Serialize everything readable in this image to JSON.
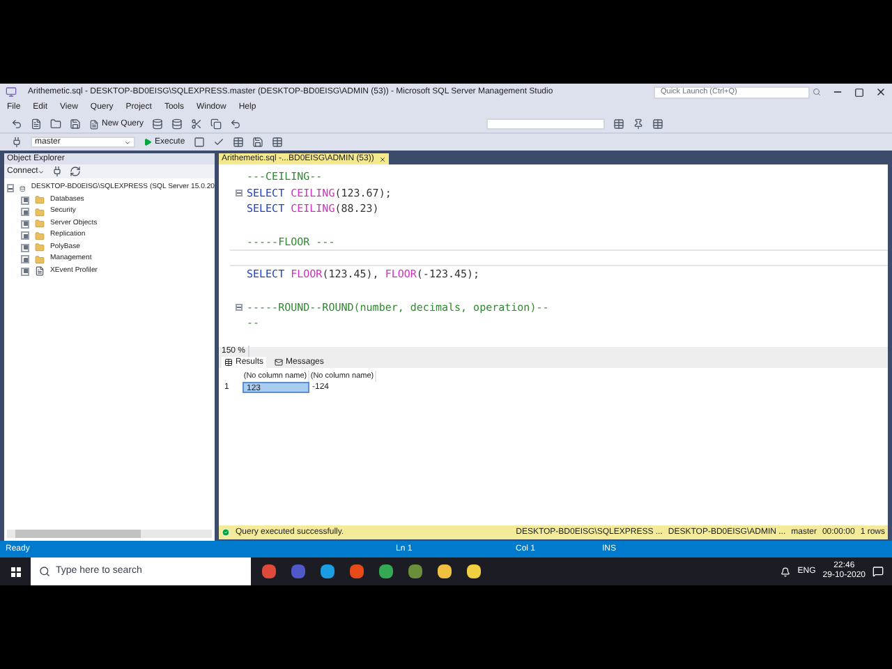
{
  "window": {
    "title": "Arithemetic.sql - DESKTOP-BD0EISG\\SQLEXPRESS.master (DESKTOP-BD0EISG\\ADMIN (53)) - Microsoft SQL Server Management Studio",
    "quick_launch": {
      "placeholder": "Quick Launch (Ctrl+Q)"
    }
  },
  "menu": [
    "File",
    "Edit",
    "View",
    "Query",
    "Project",
    "Tools",
    "Window",
    "Help"
  ],
  "toolbar": {
    "new_query": "New Query",
    "database": "master",
    "execute": "Execute"
  },
  "object_explorer": {
    "title": "Object Explorer",
    "connect": "Connect",
    "tree": [
      {
        "label": "DESKTOP-BD0EISG\\SQLEXPRESS (SQL Server 15.0.20",
        "kind": "server",
        "expanded": true,
        "children": [
          {
            "label": "Databases",
            "kind": "folder",
            "expanded": false
          },
          {
            "label": "Security",
            "kind": "folder",
            "expanded": false
          },
          {
            "label": "Server Objects",
            "kind": "folder",
            "expanded": false
          },
          {
            "label": "Replication",
            "kind": "folder",
            "expanded": false
          },
          {
            "label": "PolyBase",
            "kind": "folder",
            "expanded": false
          },
          {
            "label": "Management",
            "kind": "folder",
            "expanded": false
          },
          {
            "label": "XEvent Profiler",
            "kind": "profiler",
            "expanded": false
          }
        ]
      }
    ]
  },
  "editor": {
    "tab": {
      "label": "Arithemetic.sql -...BD0EISG\\ADMIN (53))",
      "selected": true
    },
    "zoom": "150 %",
    "lines": [
      {
        "fold": false,
        "current": false,
        "tokens": [
          {
            "kind": "comment",
            "text": "---CEILING--"
          }
        ]
      },
      {
        "fold": true,
        "current": false,
        "tokens": [
          {
            "kind": "keyword",
            "text": "SELECT "
          },
          {
            "kind": "function",
            "text": "CEILING"
          },
          {
            "kind": "plain",
            "text": "(123.67);"
          }
        ]
      },
      {
        "fold": false,
        "current": false,
        "tokens": [
          {
            "kind": "keyword",
            "text": "SELECT "
          },
          {
            "kind": "function",
            "text": "CEILING"
          },
          {
            "kind": "plain",
            "text": "(88.23)"
          }
        ]
      },
      {
        "fold": false,
        "current": false,
        "tokens": [
          {
            "kind": "blank"
          }
        ]
      },
      {
        "fold": false,
        "current": false,
        "tokens": [
          {
            "kind": "comment",
            "text": "-----FLOOR ---"
          }
        ]
      },
      {
        "fold": false,
        "current": true,
        "tokens": [
          {
            "kind": "blank"
          }
        ]
      },
      {
        "fold": false,
        "current": false,
        "tokens": [
          {
            "kind": "keyword",
            "text": "SELECT "
          },
          {
            "kind": "function",
            "text": "FLOOR"
          },
          {
            "kind": "plain",
            "text": "(123.45), "
          },
          {
            "kind": "function",
            "text": "FLOOR"
          },
          {
            "kind": "plain",
            "text": "(-123.45);"
          }
        ]
      },
      {
        "fold": false,
        "current": false,
        "tokens": [
          {
            "kind": "blank"
          }
        ]
      },
      {
        "fold": true,
        "current": false,
        "tokens": [
          {
            "kind": "comment",
            "text": "-----ROUND--ROUND(number, decimals, operation)--"
          }
        ]
      },
      {
        "fold": false,
        "current": false,
        "tokens": [
          {
            "kind": "comment",
            "text": "--"
          }
        ]
      }
    ]
  },
  "results": {
    "tabs": [
      {
        "label": "Results",
        "selected": true
      },
      {
        "label": "Messages",
        "selected": false
      }
    ],
    "columns": [
      "(No column name)",
      "(No column name)"
    ],
    "rows": [
      {
        "number": "1",
        "cells": [
          {
            "text": "123",
            "selected": true
          },
          {
            "text": "-124",
            "selected": false
          }
        ]
      }
    ],
    "status": {
      "message": "Query executed successfully.",
      "server": "DESKTOP-BD0EISG\\SQLEXPRESS ...",
      "user": "DESKTOP-BD0EISG\\ADMIN ...",
      "database": "master",
      "time": "00:00:00",
      "rows": "1 rows"
    }
  },
  "status_bar": {
    "state": "Ready",
    "line": "Ln 1",
    "column": "Col 1",
    "mode": "INS"
  },
  "taskbar": {
    "search": {
      "placeholder": "Type here to search"
    },
    "language": "ENG",
    "time": "22:46",
    "date": "29-10-2020"
  }
}
